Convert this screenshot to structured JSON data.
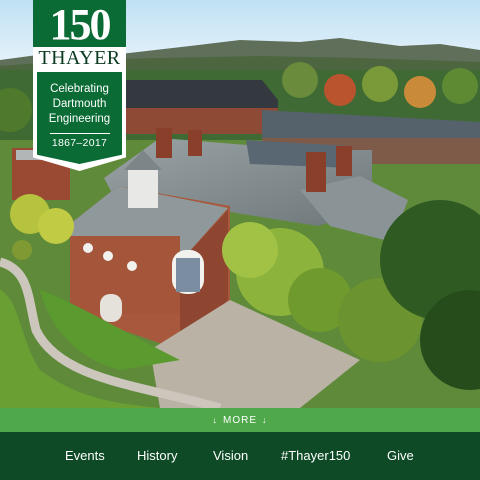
{
  "badge": {
    "number": "150",
    "wordmark": "THAYER",
    "lines": [
      "Celebrating",
      "Dartmouth",
      "Engineering"
    ],
    "years": "1867–2017"
  },
  "more": {
    "label": "MORE",
    "arrow": "↓"
  },
  "nav": {
    "items": [
      "Events",
      "History",
      "Vision",
      "#Thayer150",
      "Give"
    ]
  },
  "colors": {
    "badge_green": "#0a6b35",
    "more_bar": "#4fa84a",
    "nav_bg": "#0d4a25"
  },
  "hero": {
    "icon": "aerial-campus-photo"
  }
}
